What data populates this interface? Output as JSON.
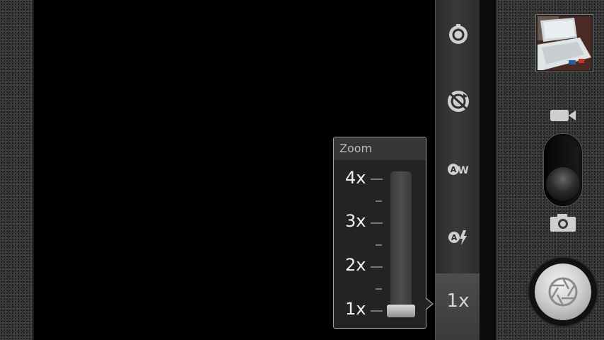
{
  "zoom_popup": {
    "title": "Zoom",
    "levels": [
      "4x",
      "3x",
      "2x",
      "1x"
    ],
    "current_value": 1,
    "max_value": 4
  },
  "settings_bar": {
    "icons": [
      "timer-icon",
      "rotate-lock-icon",
      "auto-white-balance-icon",
      "auto-flash-icon"
    ],
    "zoom_label": "1x"
  },
  "controls": {
    "mode_switch": {
      "options": [
        "video",
        "camera"
      ],
      "selected": "camera"
    }
  },
  "colors": {
    "background": "#000000",
    "panel": "#3a3a3a",
    "text": "#efefef",
    "accent": "#d6d6d6"
  }
}
